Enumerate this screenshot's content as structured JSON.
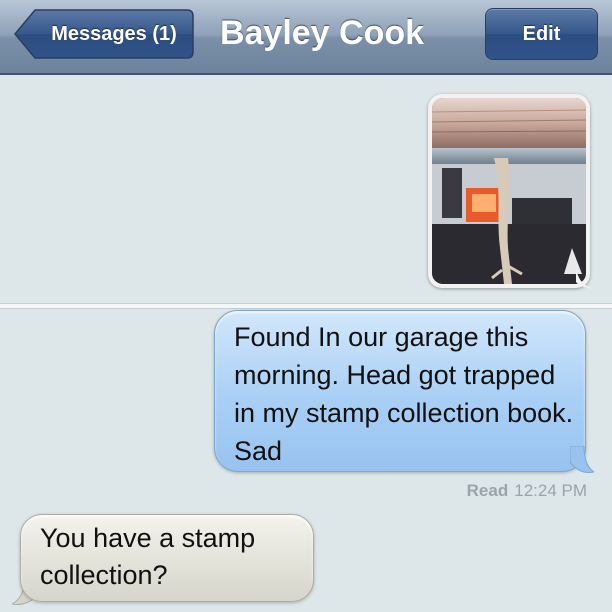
{
  "navbar": {
    "back_label": "Messages (1)",
    "title": "Bayley Cook",
    "edit_label": "Edit"
  },
  "messages": [
    {
      "type": "image",
      "direction": "sent",
      "description": "photo of a lizard caught in a stamp collection book"
    },
    {
      "type": "text",
      "direction": "sent",
      "text": "Found In our garage this morning. Head got trapped in my stamp collection book. Sad"
    },
    {
      "type": "text",
      "direction": "received",
      "text": "You have a stamp collection?"
    }
  ],
  "receipt": {
    "status": "Read",
    "time": "12:24 PM"
  },
  "colors": {
    "navbar": "#7b90a8",
    "sent_bubble": "#a9cff5",
    "received_bubble": "#e2e1d8",
    "background": "#dde6e8"
  },
  "icons": {
    "back": "chevron-left-icon"
  }
}
